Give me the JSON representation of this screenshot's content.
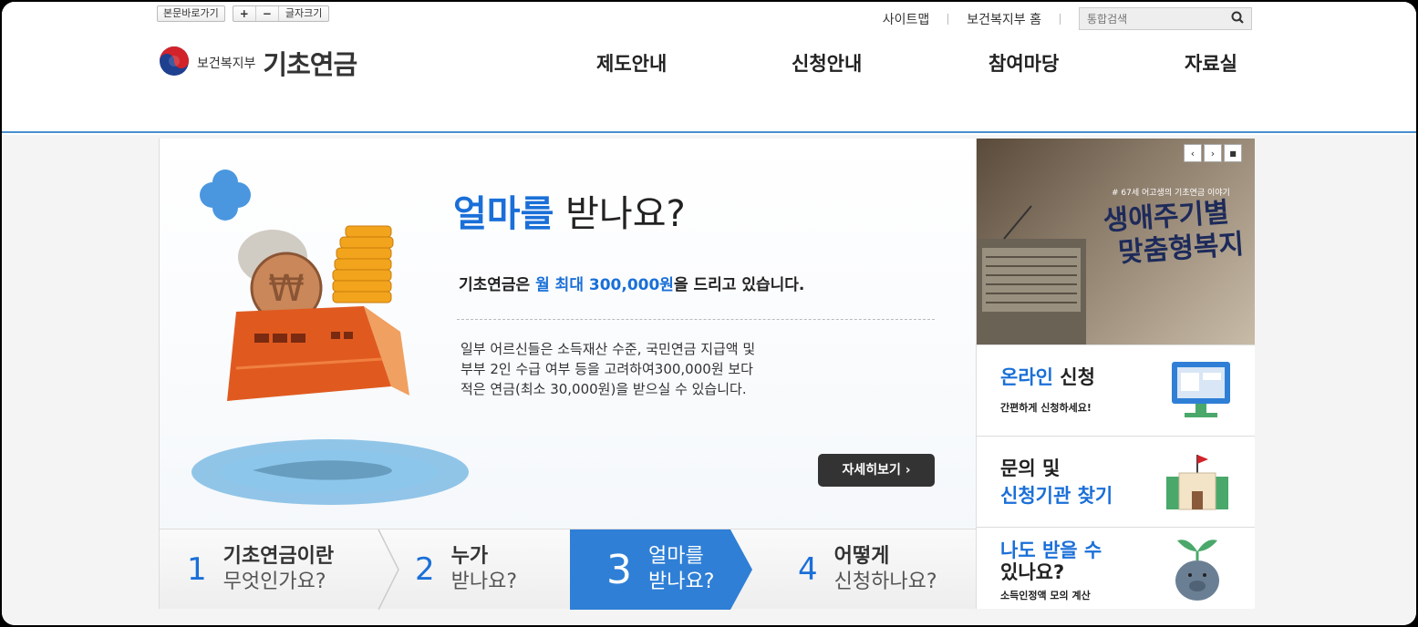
{
  "header": {
    "skip_link": "본문바로가기",
    "font_plus": "+",
    "font_minus": "−",
    "font_label": "글자크기",
    "util_links": [
      "사이트맵",
      "보건복지부 홈"
    ],
    "search_placeholder": "통합검색",
    "logo_ministry": "보건복지부",
    "logo_brand": "기초연금",
    "nav": [
      "제도안내",
      "신청안내",
      "참여마당",
      "자료실"
    ]
  },
  "hero": {
    "title_blue": "얼마를",
    "title_rest": " 받나요?",
    "lead_pre": "기초연금은 ",
    "lead_blue": "월 최대 300,000원",
    "lead_post": "을 드리고 있습니다.",
    "desc": "일부 어르신들은 소득재산 수준, 국민연금 지급액 및\n부부 2인 수급 여부 등을 고려하여300,000원 보다\n적은 연금(최소 30,000원)을 받으실 수 있습니다.",
    "more_label": "자세히보기 ›"
  },
  "steps": [
    {
      "num": "1",
      "line1": "기초연금이란",
      "line2": "무엇인가요?"
    },
    {
      "num": "2",
      "line1": "누가",
      "line2": "받나요?"
    },
    {
      "num": "3",
      "line1": "얼마를",
      "line2": "받나요?",
      "active": true
    },
    {
      "num": "4",
      "line1": "어떻게",
      "line2": "신청하나요?"
    }
  ],
  "banner": {
    "subtitle": "# 67세 어고생의 기초연금 이야기",
    "title_line1": "생애주기별",
    "title_line2": "맞춤형복지",
    "prev": "‹",
    "next": "›",
    "stop": "■"
  },
  "cards": {
    "online_blue": "온라인",
    "online_rest": " 신청",
    "online_sub": "간편하게 신청하세요!",
    "inquiry_line1": "문의 및",
    "inquiry_line2": "신청기관 찾기",
    "calc_line1": "나도 받을 수",
    "calc_line2": "있나요?",
    "calc_sub": "소득인정액 모의 계산"
  },
  "colors": {
    "accent": "#1a6fd8",
    "active_step": "#2f7fd6",
    "header_line": "#4a8fce"
  },
  "icons": [
    "search-icon",
    "taegeuk-logo-icon",
    "monitor-icon",
    "castle-icon",
    "piggybank-icon",
    "coins-card-icon"
  ]
}
